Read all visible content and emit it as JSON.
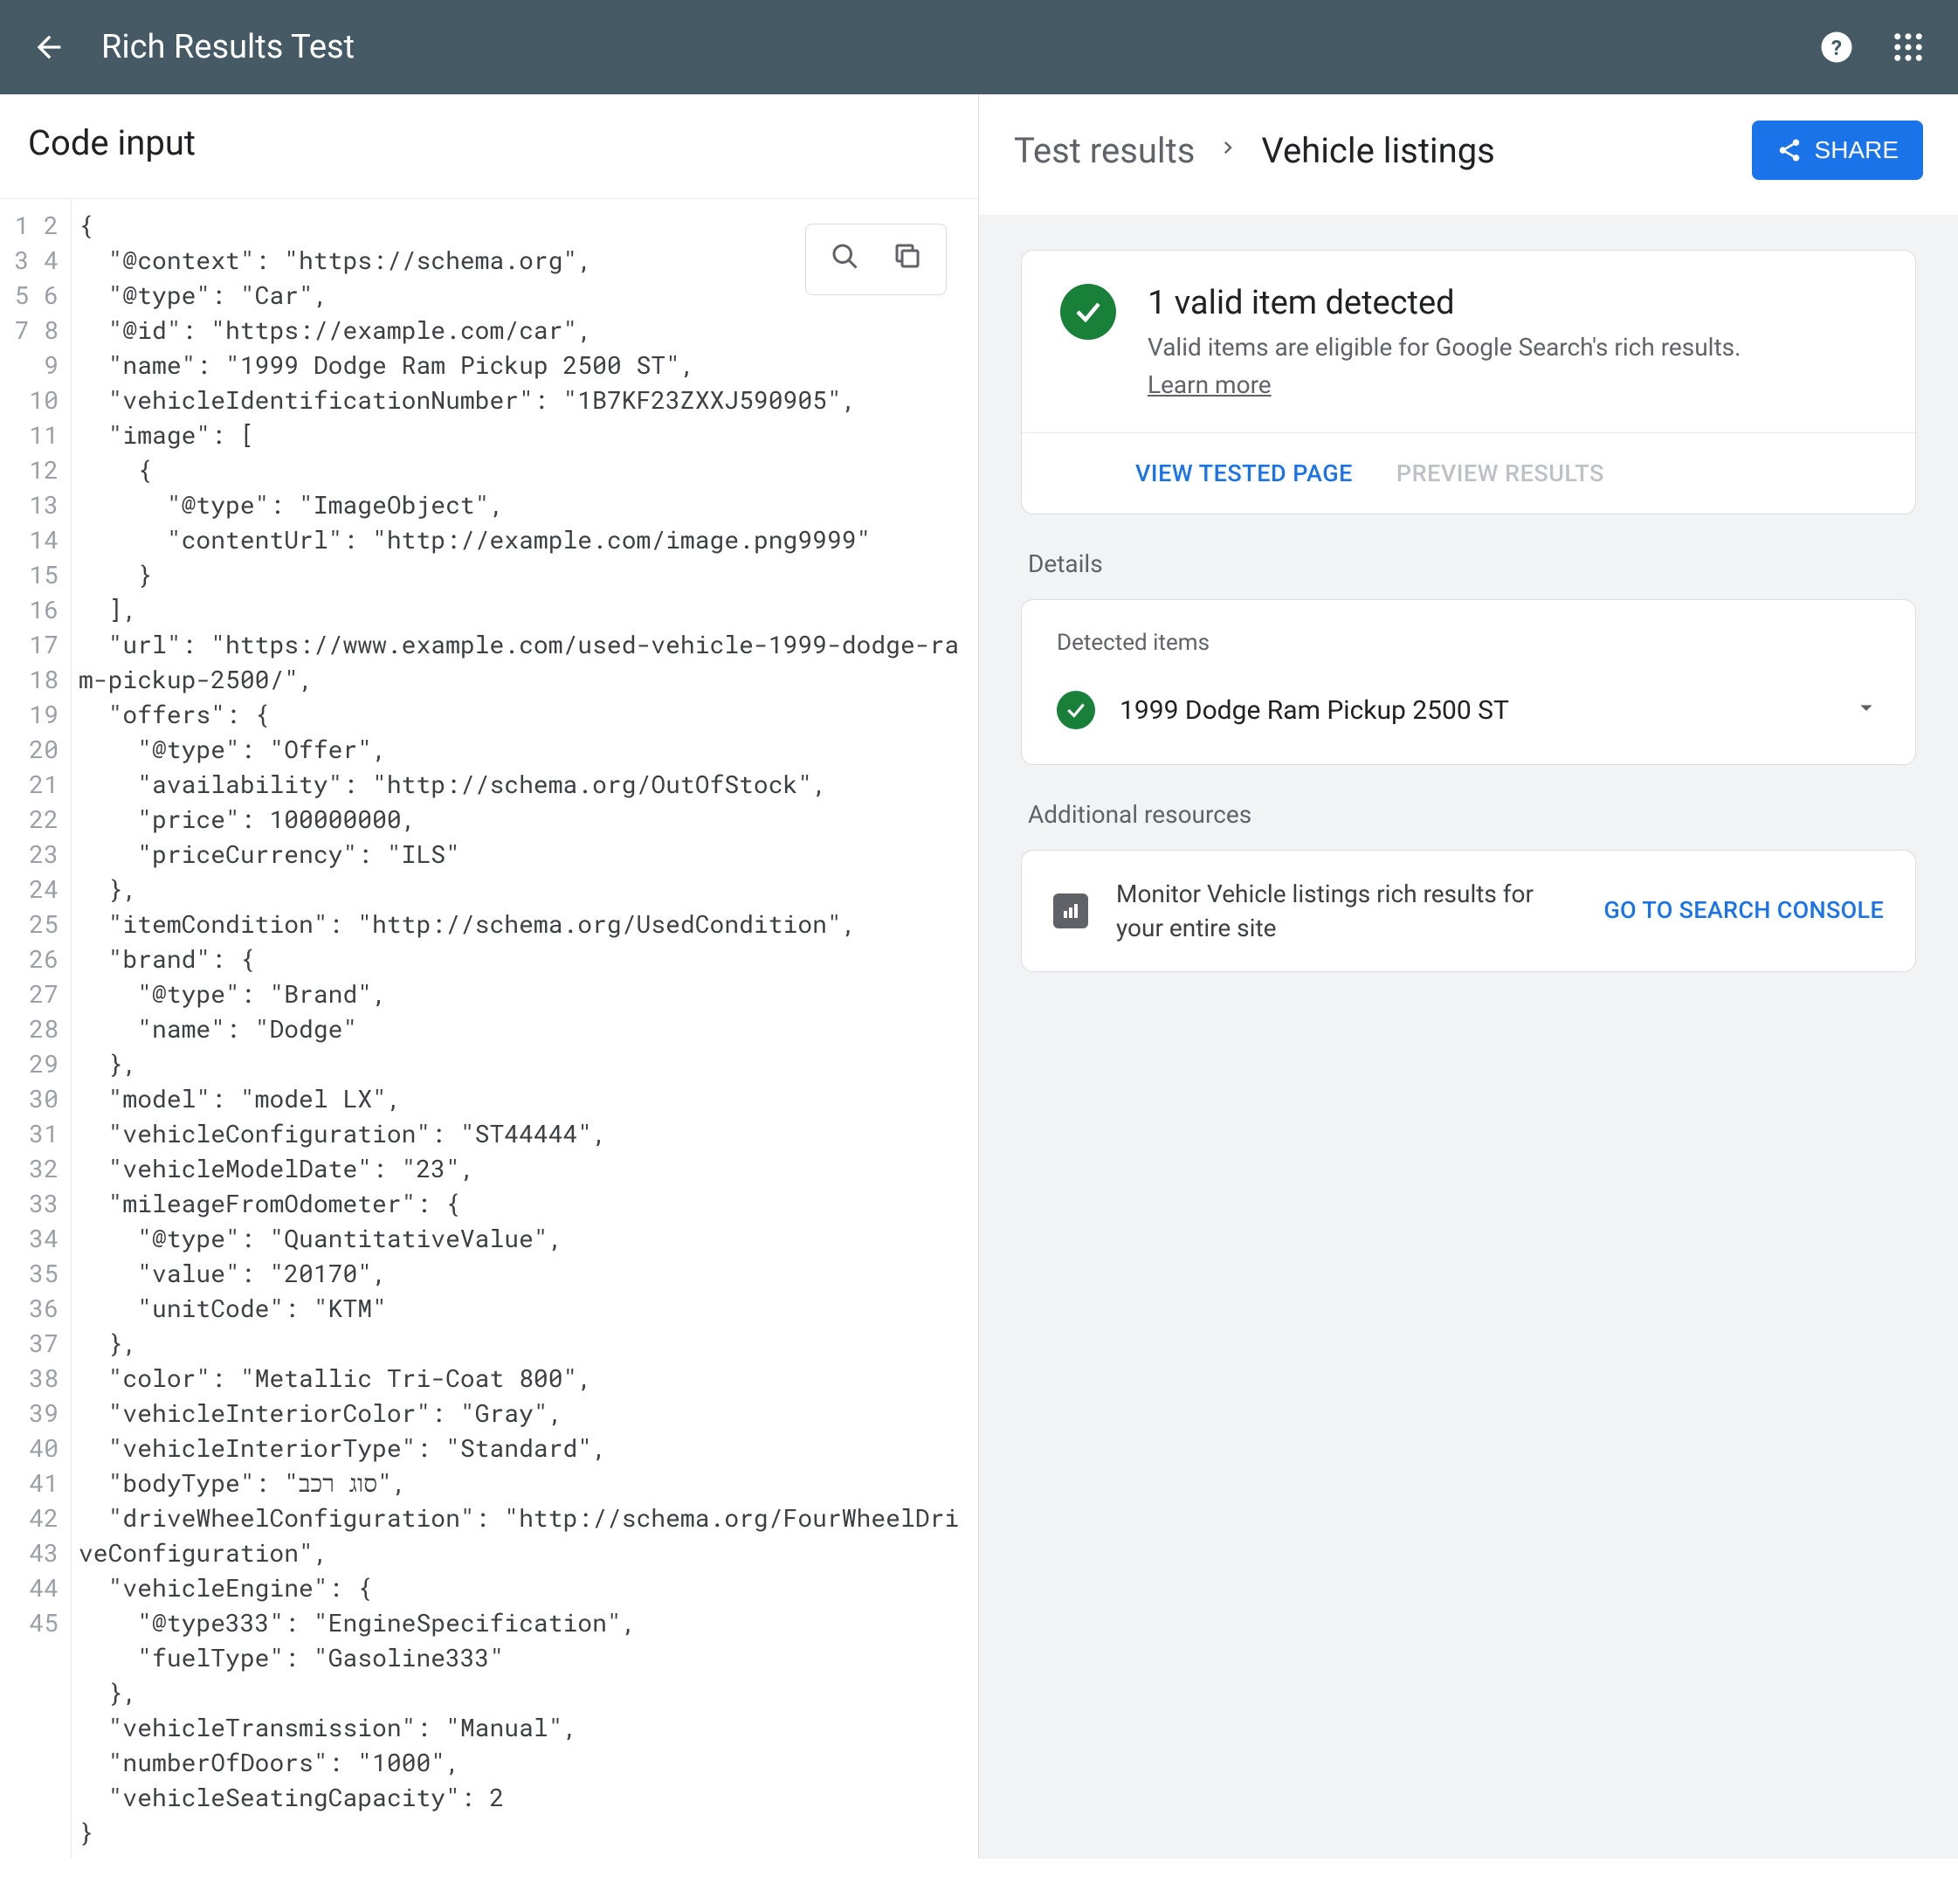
{
  "topbar": {
    "title": "Rich Results Test"
  },
  "leftHeader": "Code input",
  "code": {
    "lines": [
      "{",
      "  \"@context\": \"https://schema.org\",",
      "  \"@type\": \"Car\",",
      "  \"@id\": \"https://example.com/car\",",
      "  \"name\": \"1999 Dodge Ram Pickup 2500 ST\",",
      "  \"vehicleIdentificationNumber\": \"1B7KF23ZXXJ590905\",",
      "  \"image\": [",
      "    {",
      "      \"@type\": \"ImageObject\",",
      "      \"contentUrl\": \"http://example.com/image.png9999\"",
      "    }",
      "  ],",
      "  \"url\": \"https://www.example.com/used-vehicle-1999-dodge-ram-pickup-2500/\",",
      "  \"offers\": {",
      "    \"@type\": \"Offer\",",
      "    \"availability\": \"http://schema.org/OutOfStock\",",
      "    \"price\": 100000000,",
      "    \"priceCurrency\": \"ILS\"",
      "  },",
      "  \"itemCondition\": \"http://schema.org/UsedCondition\",",
      "  \"brand\": {",
      "    \"@type\": \"Brand\",",
      "    \"name\": \"Dodge\"",
      "  },",
      "  \"model\": \"model LX\",",
      "  \"vehicleConfiguration\": \"ST44444\",",
      "  \"vehicleModelDate\": \"23\",",
      "  \"mileageFromOdometer\": {",
      "    \"@type\": \"QuantitativeValue\",",
      "    \"value\": \"20170\",",
      "    \"unitCode\": \"KTM\"",
      "  },",
      "  \"color\": \"Metallic Tri-Coat 800\",",
      "  \"vehicleInteriorColor\": \"Gray\",",
      "  \"vehicleInteriorType\": \"Standard\",",
      "  \"bodyType\": \"סוג רכב\",",
      "  \"driveWheelConfiguration\": \"http://schema.org/FourWheelDriveConfiguration\",",
      "  \"vehicleEngine\": {",
      "    \"@type333\": \"EngineSpecification\",",
      "    \"fuelType\": \"Gasoline333\"",
      "  },",
      "  \"vehicleTransmission\": \"Manual\",",
      "  \"numberOfDoors\": \"1000\",",
      "  \"vehicleSeatingCapacity\": 2",
      "}"
    ]
  },
  "breadcrumb": {
    "root": "Test results",
    "leaf": "Vehicle listings"
  },
  "shareLabel": "SHARE",
  "result": {
    "headline": "1 valid item detected",
    "sub": "Valid items are eligible for Google Search's rich results.",
    "learnMore": "Learn more",
    "viewTested": "VIEW TESTED PAGE",
    "previewResults": "PREVIEW RESULTS"
  },
  "sections": {
    "details": "Details",
    "detectedItems": "Detected items",
    "additional": "Additional resources"
  },
  "detected": {
    "item": "1999 Dodge Ram Pickup 2500 ST"
  },
  "resource": {
    "text": "Monitor Vehicle listings rich results for your entire site",
    "link": "GO TO SEARCH CONSOLE"
  }
}
